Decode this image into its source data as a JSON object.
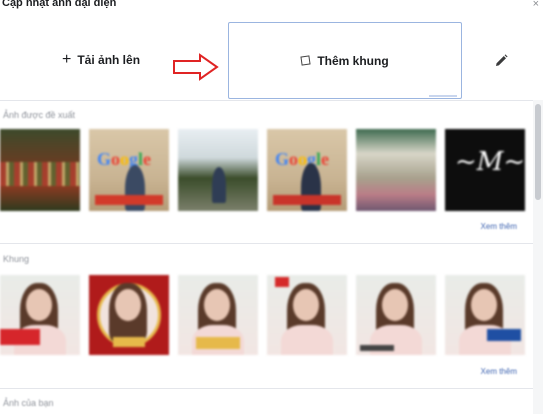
{
  "header": {
    "title": "Cập nhật ảnh đại diện",
    "close_glyph": "×"
  },
  "actions": {
    "upload_label": "Tải ảnh lên",
    "upload_icon": "plus-icon",
    "add_frame_label": "Thêm khung",
    "add_frame_icon": "square-frame-icon",
    "edit_icon": "pencil-icon",
    "annotation_arrow_color": "#e02424"
  },
  "sections": {
    "suggested": {
      "label": "Ảnh được đề xuất",
      "see_more": "Xem thêm"
    },
    "frames": {
      "label": "Khung",
      "see_more": "Xem thêm"
    },
    "your_photos": {
      "label": "Ảnh của bạn"
    }
  },
  "colors": {
    "accent": "#4267b2",
    "frame_border": "#9bb5e0",
    "banner_red": "#e12d2d"
  }
}
